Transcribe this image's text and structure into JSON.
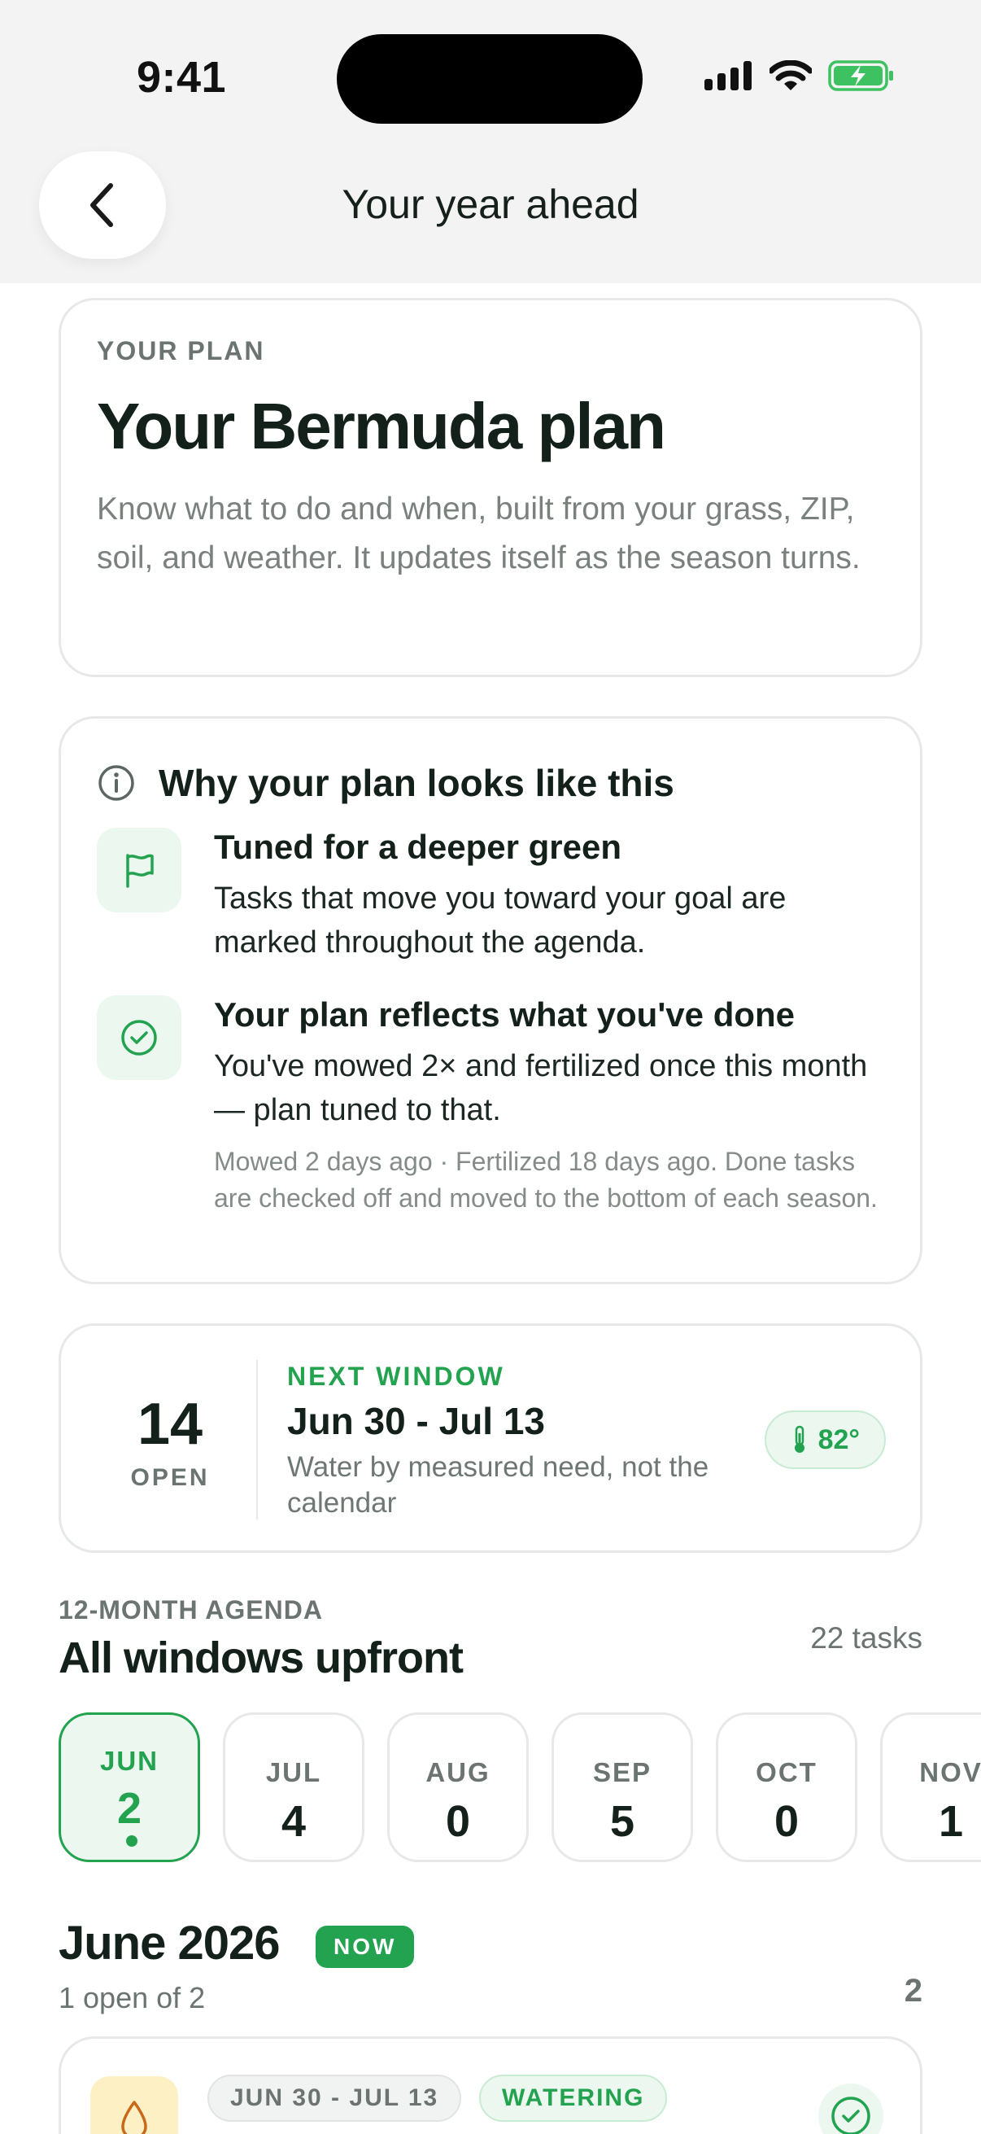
{
  "status_bar": {
    "time": "9:41"
  },
  "nav": {
    "title": "Your year ahead"
  },
  "plan": {
    "eyebrow": "YOUR PLAN",
    "title": "Your Bermuda plan",
    "description": "Know what to do and when, built from your grass, ZIP, soil, and weather. It updates itself as the season turns."
  },
  "why": {
    "title": "Why your plan looks like this",
    "items": [
      {
        "icon": "flag-icon",
        "title": "Tuned for a deeper green",
        "text": "Tasks that move you toward your goal are marked throughout the agenda.",
        "note": ""
      },
      {
        "icon": "check-circle-icon",
        "title": "Your plan reflects what you've done",
        "text": "You've mowed 2× and fertilized once this month — plan tuned to that.",
        "note": "Mowed 2 days ago · Fertilized 18 days ago. Done tasks are checked off and moved to the bottom of each season."
      }
    ]
  },
  "next_window": {
    "open_count": "14",
    "open_label": "OPEN",
    "eyebrow": "NEXT WINDOW",
    "dates": "Jun 30 - Jul 13",
    "description": "Water by measured need, not the calendar",
    "temperature": "82°"
  },
  "agenda": {
    "eyebrow": "12-MONTH AGENDA",
    "title": "All windows upfront",
    "task_count": "22 tasks",
    "months": [
      {
        "label": "JUN",
        "count": "2",
        "active": true
      },
      {
        "label": "JUL",
        "count": "4",
        "active": false
      },
      {
        "label": "AUG",
        "count": "0",
        "active": false
      },
      {
        "label": "SEP",
        "count": "5",
        "active": false
      },
      {
        "label": "OCT",
        "count": "0",
        "active": false
      },
      {
        "label": "NOV",
        "count": "1",
        "active": false
      }
    ]
  },
  "section": {
    "title": "June 2026",
    "badge": "NOW",
    "subtitle": "1 open of 2",
    "count": "2"
  },
  "task": {
    "date_chip": "JUN 30 - JUL 13",
    "category_chip": "WATERING",
    "icon": "water-drop-icon"
  },
  "colors": {
    "accent": "#23a34f",
    "accent_soft": "#ebf7ef",
    "text": "#14201a",
    "muted": "#6b7470"
  }
}
